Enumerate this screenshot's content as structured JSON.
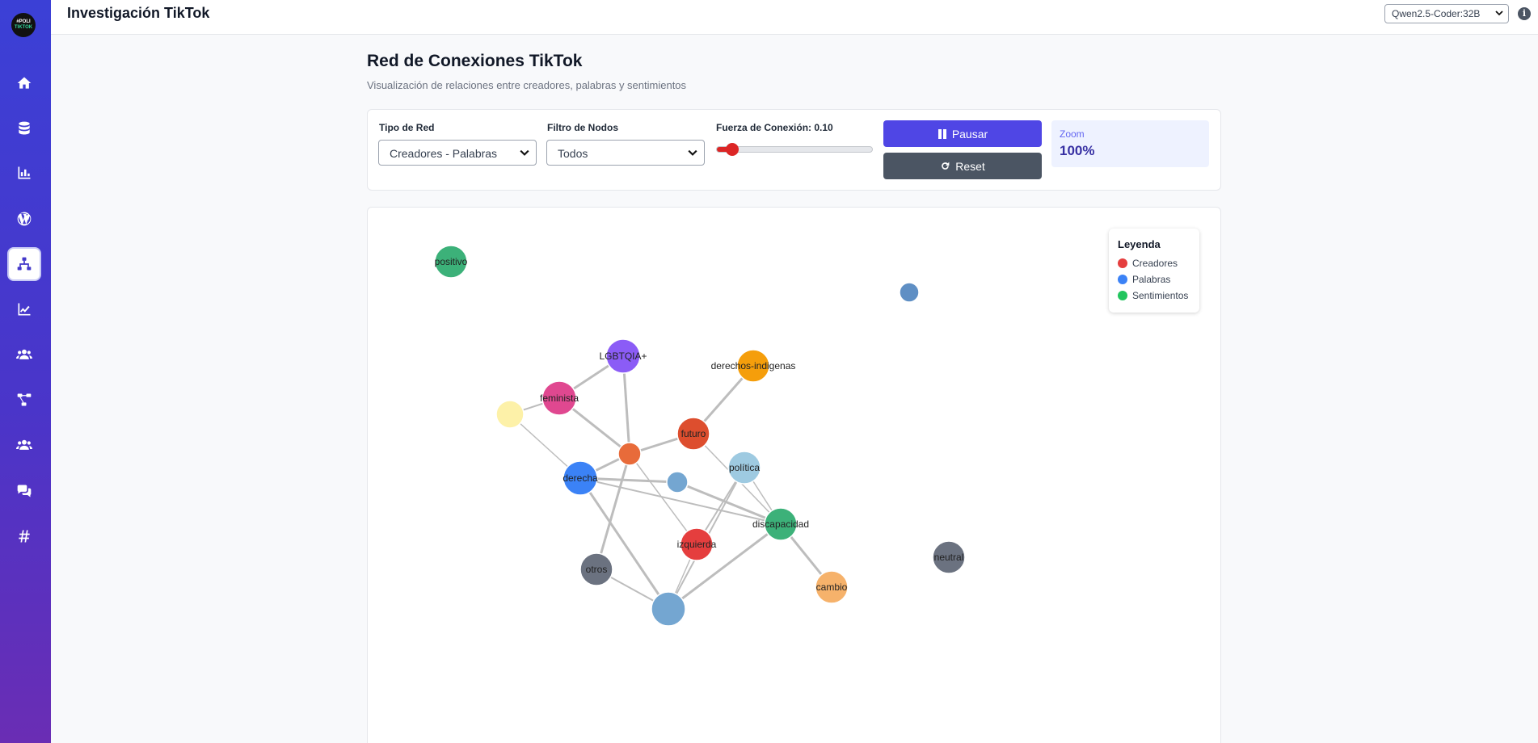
{
  "app": {
    "title": "Investigación TikTok",
    "logo_text_top": "#POLI",
    "logo_text_bottom": "TIKTOK",
    "model_selected": "Qwen2.5-Coder:32B",
    "info_icon": "info-icon"
  },
  "sidebar": {
    "items": [
      {
        "icon": "home-icon",
        "active": false
      },
      {
        "icon": "database-icon",
        "active": false
      },
      {
        "icon": "bar-chart-icon",
        "active": false
      },
      {
        "icon": "wordpress-icon",
        "active": false
      },
      {
        "icon": "network-icon",
        "active": true
      },
      {
        "icon": "line-chart-icon",
        "active": false
      },
      {
        "icon": "users-icon",
        "active": false
      },
      {
        "icon": "hierarchy-icon",
        "active": false
      },
      {
        "icon": "group-icon",
        "active": false
      },
      {
        "icon": "comments-icon",
        "active": false
      },
      {
        "icon": "hashtag-icon",
        "active": false
      }
    ]
  },
  "page": {
    "title": "Red de Conexiones TikTok",
    "subtitle": "Visualización de relaciones entre creadores, palabras y sentimientos"
  },
  "controls": {
    "network_type_label": "Tipo de Red",
    "network_type_value": "Creadores - Palabras",
    "node_filter_label": "Filtro de Nodos",
    "node_filter_value": "Todos",
    "strength_label": "Fuerza de Conexión: 0.10",
    "strength_value": 0.1,
    "pause_label": "Pausar",
    "reset_label": "Reset",
    "zoom_label": "Zoom",
    "zoom_value": "100%"
  },
  "legend": {
    "title": "Leyenda",
    "items": [
      {
        "label": "Creadores",
        "color": "#e53e3e"
      },
      {
        "label": "Palabras",
        "color": "#3b82f6"
      },
      {
        "label": "Sentimientos",
        "color": "#22c55e"
      }
    ]
  },
  "graph": {
    "nodes": [
      {
        "id": "positivo",
        "label": "positivo",
        "color": "#3cb179",
        "r": 20
      },
      {
        "id": "blue_tr",
        "label": "",
        "color": "#5f8fc4",
        "r": 12
      },
      {
        "id": "lgbtqia",
        "label": "LGBTQIA+",
        "color": "#8b5cf6",
        "r": 21
      },
      {
        "id": "derechos",
        "label": "derechos-indigenas",
        "color": "#f59e0b",
        "r": 20
      },
      {
        "id": "feminista",
        "label": "feminista",
        "color": "#e04890",
        "r": 21
      },
      {
        "id": "yellow",
        "label": "",
        "color": "#fdf1a8",
        "r": 17
      },
      {
        "id": "futuro",
        "label": "futuro",
        "color": "#dd4e2e",
        "r": 20
      },
      {
        "id": "orange_c",
        "label": "",
        "color": "#e86b3a",
        "r": 14
      },
      {
        "id": "politica",
        "label": "política",
        "color": "#9ecae1",
        "r": 20
      },
      {
        "id": "derecha",
        "label": "derecha",
        "color": "#3b82f6",
        "r": 21
      },
      {
        "id": "blue_small",
        "label": "",
        "color": "#74a6d1",
        "r": 13
      },
      {
        "id": "discapacidad",
        "label": "discapacidad",
        "color": "#3cb179",
        "r": 20
      },
      {
        "id": "izquierda",
        "label": "izquierda",
        "color": "#e53e3e",
        "r": 20
      },
      {
        "id": "otros",
        "label": "otros",
        "color": "#6b7280",
        "r": 20
      },
      {
        "id": "blue_bottom",
        "label": "",
        "color": "#74a6d1",
        "r": 21
      },
      {
        "id": "cambio",
        "label": "cambio",
        "color": "#f6b26b",
        "r": 20
      },
      {
        "id": "neutral",
        "label": "neutral",
        "color": "#6b7280",
        "r": 20
      }
    ],
    "links": [
      [
        "lgbtqia",
        "feminista",
        3
      ],
      [
        "lgbtqia",
        "orange_c",
        3
      ],
      [
        "feminista",
        "yellow",
        2
      ],
      [
        "feminista",
        "orange_c",
        3
      ],
      [
        "yellow",
        "derecha",
        1.5
      ],
      [
        "orange_c",
        "futuro",
        3
      ],
      [
        "orange_c",
        "derecha",
        3
      ],
      [
        "orange_c",
        "izquierda",
        1.5
      ],
      [
        "orange_c",
        "otros",
        3
      ],
      [
        "futuro",
        "derechos",
        3
      ],
      [
        "futuro",
        "discapacidad",
        1.5
      ],
      [
        "derecha",
        "blue_small",
        3
      ],
      [
        "derecha",
        "discapacidad",
        2
      ],
      [
        "derecha",
        "blue_bottom",
        3
      ],
      [
        "blue_small",
        "discapacidad",
        3
      ],
      [
        "politica",
        "izquierda",
        2
      ],
      [
        "politica",
        "discapacidad",
        1.5
      ],
      [
        "politica",
        "blue_bottom",
        2
      ],
      [
        "izquierda",
        "blue_bottom",
        1.5
      ],
      [
        "discapacidad",
        "blue_bottom",
        3
      ],
      [
        "discapacidad",
        "cambio",
        3
      ],
      [
        "otros",
        "blue_bottom",
        2
      ]
    ]
  }
}
